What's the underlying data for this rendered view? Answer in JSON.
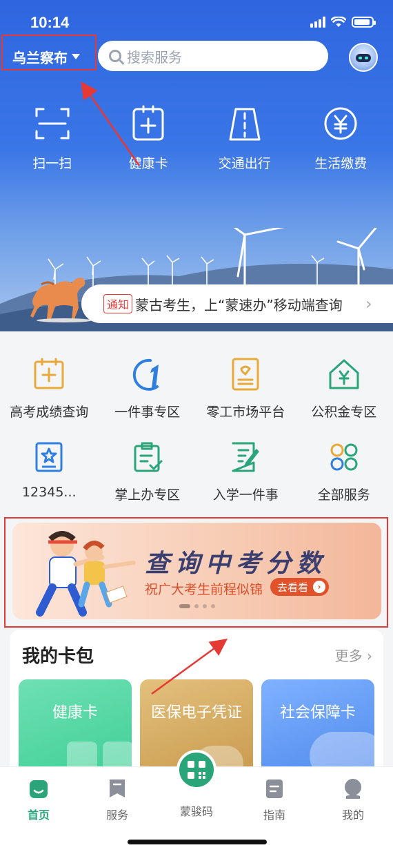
{
  "status_bar": {
    "time": "10:14"
  },
  "header": {
    "city": "乌兰察布",
    "search_placeholder": "搜索服务"
  },
  "quick_actions": [
    {
      "label": "扫一扫",
      "icon": "scan-icon"
    },
    {
      "label": "健康卡",
      "icon": "health-card-icon"
    },
    {
      "label": "交通出行",
      "icon": "road-icon"
    },
    {
      "label": "生活缴费",
      "icon": "yuan-coin-icon"
    }
  ],
  "notice": {
    "tag": "通知",
    "text": "蒙古考生，上“蒙速办”移动端查询"
  },
  "services": {
    "row1": [
      {
        "label": "高考成绩查询",
        "icon": "calendar-plus-icon"
      },
      {
        "label": "一件事专区",
        "icon": "number-one-icon"
      },
      {
        "label": "零工市场平台",
        "icon": "resume-icon"
      },
      {
        "label": "公积金专区",
        "icon": "house-yuan-icon"
      }
    ],
    "row2": [
      {
        "label": "12345...",
        "icon": "star-card-icon"
      },
      {
        "label": "掌上办专区",
        "icon": "clipboard-check-icon"
      },
      {
        "label": "入学一件事",
        "icon": "document-pen-icon"
      },
      {
        "label": "全部服务",
        "icon": "four-circles-icon"
      }
    ]
  },
  "banner": {
    "title": "查询中考分数",
    "subtitle": "祝广大考生前程似锦",
    "button": "去看看"
  },
  "wallet": {
    "title": "我的卡包",
    "more": "更多",
    "cards": [
      "健康卡",
      "医保电子凭证",
      "社会保障卡"
    ]
  },
  "tabbar": {
    "items": [
      "首页",
      "服务",
      "蒙骏码",
      "指南",
      "我的"
    ],
    "active": "首页"
  },
  "colors": {
    "brand_blue": "#3a76e6",
    "brand_green": "#2aa57a",
    "annotation_red": "#e53935"
  }
}
